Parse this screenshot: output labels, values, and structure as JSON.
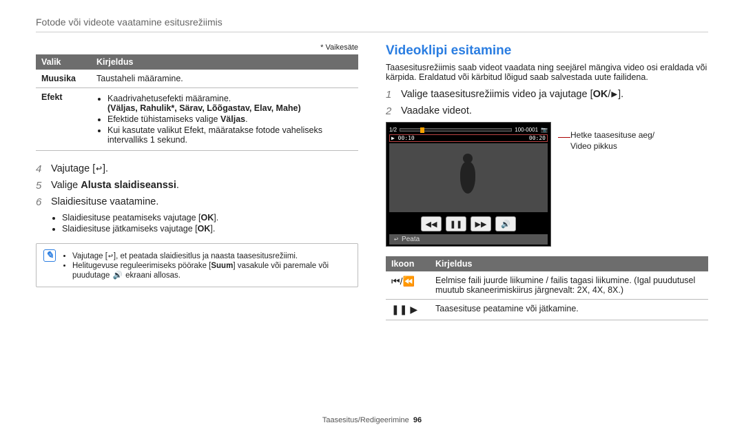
{
  "header": "Fotode või videote vaatamine esitusrežiimis",
  "footnote": "* Vaikesäte",
  "options_table": {
    "head_option": "Valik",
    "head_desc": "Kirjeldus",
    "rows": [
      {
        "k": "Muusika",
        "lines": [
          "Taustaheli määramine."
        ]
      },
      {
        "k": "Efekt",
        "lines": [
          "Kaadrivahetusefekti määramine.",
          "(Väljas, Rahulik*, Särav, Lõõgastav, Elav, Mahe)",
          "Efektide tühistamiseks valige Väljas.",
          "Kui kasutate valikut Efekt, määratakse fotode vaheliseks intervalliks 1 sekund."
        ]
      }
    ]
  },
  "left_steps": {
    "s4": "Vajutage [",
    "s4_tail": "].",
    "s5_pre": "Valige ",
    "s5_bold": "Alusta slaidiseanssi",
    "s5_post": ".",
    "s6": "Slaidiesituse vaatamine.",
    "sub": [
      "Slaidiesituse peatamiseks vajutage [",
      "Slaidiesituse jätkamiseks vajutage ["
    ],
    "sub_tail": "].",
    "ok_text": "OK"
  },
  "info": {
    "l1_a": "Vajutage [",
    "l1_b": "], et peatada slaidiesitlus ja naasta taasesitusrežiimi.",
    "l2_a": "Helitugevuse reguleerimiseks pöörake [",
    "l2_bold": "Suum",
    "l2_b": "] vasakule või paremale või puudutage ",
    "l2_c": " ekraani allosas."
  },
  "section_title": "Videoklipi esitamine",
  "intro": "Taasesitusrežiimis saab videot vaadata ning seejärel mängiva video osi eraldada või kärpida. Eraldatud või kärbitud lõigud saab salvestada uute failidena.",
  "right_steps": {
    "s1_a": "Valige taasesitusrežiimis video ja vajutage [",
    "s1_b": "].",
    "s2": "Vaadake videot.",
    "ok_text": "OK"
  },
  "video": {
    "counter": "1/2",
    "t_left": "00:10",
    "t_right": "00:20",
    "battery_ish": "100-0001",
    "stop_label": "Peata"
  },
  "callout": {
    "l1": "Hetke taasesituse aeg/",
    "l2": "Video pikkus"
  },
  "icons_table": {
    "head_icon": "Ikoon",
    "head_desc": "Kirjeldus",
    "rows": [
      {
        "icon": "⏮/⏪",
        "desc": "Eelmise faili juurde liikumine / failis tagasi liikumine. (Igal puudutusel muutub skaneerimiskiirus järgnevalt: 2X, 4X, 8X.)"
      },
      {
        "icon": "❚❚ ▶",
        "desc": "Taasesituse peatamine või jätkamine."
      }
    ]
  },
  "footer": {
    "text": "Taasesitus/Redigeerimine",
    "page": "96"
  }
}
